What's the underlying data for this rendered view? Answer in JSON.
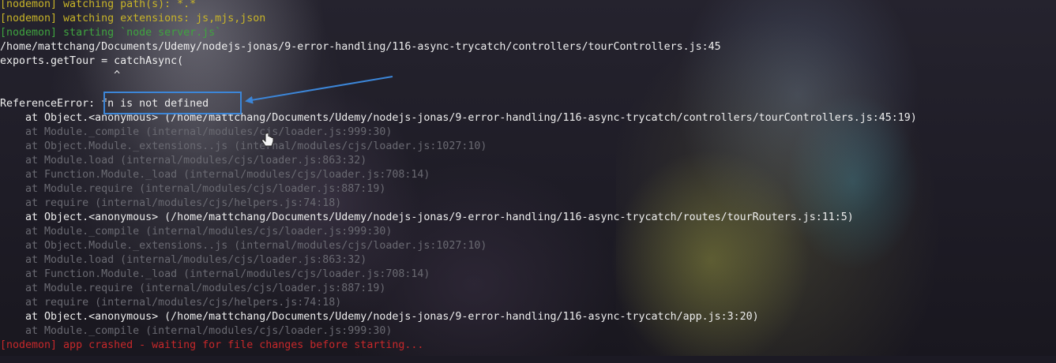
{
  "terminal": {
    "lines": [
      {
        "text": "[nodemon] watching path(s): *.*",
        "color": "yellow"
      },
      {
        "text": "[nodemon] watching extensions: js,mjs,json",
        "color": "yellow"
      },
      {
        "text": "[nodemon] starting `node server.js`",
        "color": "green"
      },
      {
        "text": "/home/mattchang/Documents/Udemy/nodejs-jonas/9-error-handling/116-async-trycatch/controllers/tourControllers.js:45",
        "color": "white"
      },
      {
        "text": "exports.getTour = catchAsync(",
        "color": "white"
      },
      {
        "text": "                  ^",
        "color": "white"
      },
      {
        "text": "",
        "color": "white"
      },
      {
        "text": "ReferenceError: fn is not defined",
        "color": "white"
      },
      {
        "text": "    at Object.<anonymous> (/home/mattchang/Documents/Udemy/nodejs-jonas/9-error-handling/116-async-trycatch/controllers/tourControllers.js:45:19)",
        "color": "white"
      },
      {
        "text": "    at Module._compile (internal/modules/cjs/loader.js:999:30)",
        "color": "dim"
      },
      {
        "text": "    at Object.Module._extensions..js (internal/modules/cjs/loader.js:1027:10)",
        "color": "dim"
      },
      {
        "text": "    at Module.load (internal/modules/cjs/loader.js:863:32)",
        "color": "dim"
      },
      {
        "text": "    at Function.Module._load (internal/modules/cjs/loader.js:708:14)",
        "color": "dim"
      },
      {
        "text": "    at Module.require (internal/modules/cjs/loader.js:887:19)",
        "color": "dim"
      },
      {
        "text": "    at require (internal/modules/cjs/helpers.js:74:18)",
        "color": "dim"
      },
      {
        "text": "    at Object.<anonymous> (/home/mattchang/Documents/Udemy/nodejs-jonas/9-error-handling/116-async-trycatch/routes/tourRouters.js:11:5)",
        "color": "white"
      },
      {
        "text": "    at Module._compile (internal/modules/cjs/loader.js:999:30)",
        "color": "dim"
      },
      {
        "text": "    at Object.Module._extensions..js (internal/modules/cjs/loader.js:1027:10)",
        "color": "dim"
      },
      {
        "text": "    at Module.load (internal/modules/cjs/loader.js:863:32)",
        "color": "dim"
      },
      {
        "text": "    at Function.Module._load (internal/modules/cjs/loader.js:708:14)",
        "color": "dim"
      },
      {
        "text": "    at Module.require (internal/modules/cjs/loader.js:887:19)",
        "color": "dim"
      },
      {
        "text": "    at require (internal/modules/cjs/helpers.js:74:18)",
        "color": "dim"
      },
      {
        "text": "    at Object.<anonymous> (/home/mattchang/Documents/Udemy/nodejs-jonas/9-error-handling/116-async-trycatch/app.js:3:20)",
        "color": "white"
      },
      {
        "text": "    at Module._compile (internal/modules/cjs/loader.js:999:30)",
        "color": "dim"
      },
      {
        "text": "[nodemon] app crashed - waiting for file changes before starting...",
        "color": "red"
      }
    ]
  },
  "annotation": {
    "highlight_color": "#3c86d8",
    "icon": "pointer-cursor-icon"
  },
  "colors": {
    "yellow": "#c8b428",
    "green": "#3fa43f",
    "white": "#eeeeee",
    "dim": "#6a6a72",
    "red": "#c8282a"
  }
}
